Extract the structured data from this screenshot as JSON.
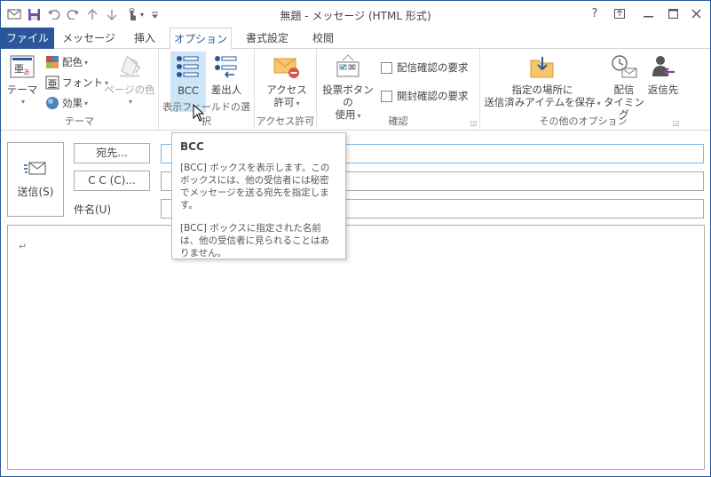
{
  "window": {
    "title": "無題 - メッセージ (HTML 形式)"
  },
  "qat": {
    "icons": [
      "outlook-icon",
      "save-icon",
      "undo-icon",
      "redo-icon",
      "up-arrow-icon",
      "down-arrow-icon",
      "touch-mode-icon",
      "customize-icon"
    ]
  },
  "window_controls": {
    "help": "?",
    "ribbon_display": "",
    "minimize": "",
    "maximize": "",
    "close": ""
  },
  "tabs": [
    {
      "label": "ファイル"
    },
    {
      "label": "メッセージ"
    },
    {
      "label": "挿入"
    },
    {
      "label": "オプション"
    },
    {
      "label": "書式設定"
    },
    {
      "label": "校閲"
    }
  ],
  "active_tab": "オプション",
  "ribbon": {
    "theme_group": {
      "label": "テーマ",
      "theme_button": "テーマ",
      "colors": "配色",
      "fonts": "フォント",
      "effects": "効果",
      "page_color": "ページの色"
    },
    "show_fields_group": {
      "label": "表示フィールドの選択",
      "bcc": "BCC",
      "from": "差出人"
    },
    "permission_group": {
      "label": "アクセス許可",
      "button_line1": "アクセス",
      "button_line2": "許可"
    },
    "tracking_group": {
      "label": "確認",
      "voting_line1": "投票ボタンの",
      "voting_line2": "使用",
      "delivery_receipt": "配信確認の要求",
      "read_receipt": "開封確認の要求"
    },
    "more_options_group": {
      "label": "その他のオプション",
      "save_sent_line1": "指定の場所に",
      "save_sent_line2": "送信済みアイテムを保存",
      "delay_line1": "配信",
      "delay_line2": "タイミング",
      "direct_replies": "返信先"
    }
  },
  "compose": {
    "send": "送信(S)",
    "to": "宛先...",
    "cc": "C C (C)...",
    "subject": "件名(U)",
    "to_value": "",
    "cc_value": "",
    "subject_value": "",
    "body_mark": "↵"
  },
  "tooltip": {
    "title": "BCC",
    "para1": "[BCC] ボックスを表示します。このボックスには、他の受信者には秘密でメッセージを送る宛先を指定します。",
    "para2": "[BCC] ボックスに指定された名前は、他の受信者に見られることはありません。"
  },
  "colors": {
    "accent": "#2b579a",
    "selected_button": "#cde6f7",
    "tooltip_border": "#bebebe"
  }
}
